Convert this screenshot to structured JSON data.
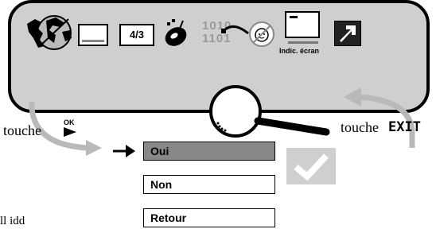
{
  "screen": {
    "indicator_label": "Indic. écran",
    "format_label": "4/3",
    "code_top": "1010",
    "code_bottom": "1101"
  },
  "menu": {
    "options": [
      {
        "label": "Oui",
        "selected": true
      },
      {
        "label": "Non",
        "selected": false
      },
      {
        "label": "Retour",
        "selected": false
      }
    ]
  },
  "captions": {
    "left": "touche",
    "ok_key": "OK",
    "right": "touche",
    "exit_key": "EXIT",
    "bottom_fragment": "ll idd"
  },
  "colors": {
    "panel": "#cfcfcf",
    "selected": "#888888",
    "arrow_gray": "#b9b9b9"
  }
}
